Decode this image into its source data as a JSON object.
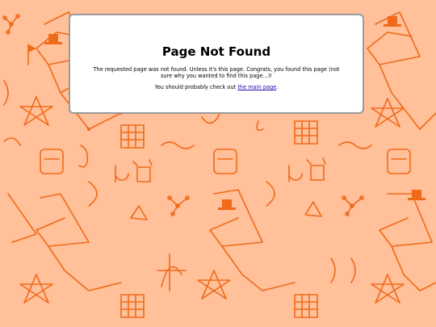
{
  "page": {
    "title": "Page Not Found",
    "message": "The requested page was not found. Unless it's this page. Congrats, you found this page (not sure why you wanted to find this page...)!",
    "hint_prefix": "You should probably check out ",
    "main_link": "the main page",
    "hint_suffix": "."
  },
  "colors": {
    "background": "#ffc09a",
    "doodle": "#f06a1a",
    "link": "#1a0dab"
  },
  "background_icons": [
    "network-icon",
    "pentagram-icon",
    "rubiks-cube-icon",
    "antenna-icon",
    "top-hat-icon",
    "triangle-icon",
    "abstract-figure-icon",
    "scribble-icon"
  ]
}
